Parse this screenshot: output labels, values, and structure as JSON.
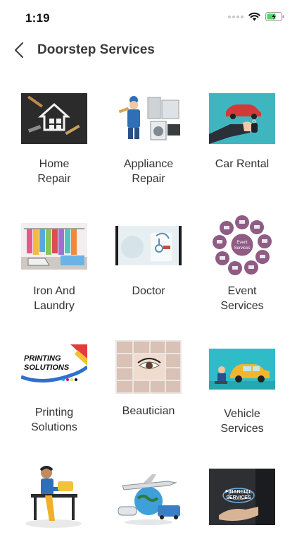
{
  "status": {
    "time": "1:19"
  },
  "nav": {
    "title": "Doorstep Services"
  },
  "services": [
    {
      "label": "Home\nRepair"
    },
    {
      "label": "Appliance\nRepair"
    },
    {
      "label": "Car Rental"
    },
    {
      "label": "Iron And\nLaundry"
    },
    {
      "label": "Doctor"
    },
    {
      "label": "Event\nServices"
    },
    {
      "label": "Printing\nSolutions"
    },
    {
      "label": "Beautician"
    },
    {
      "label": "Vehicle\nServices"
    },
    {
      "label": ""
    },
    {
      "label": ""
    },
    {
      "label": ""
    }
  ],
  "thumb_text": {
    "event_center": "Event\nServices",
    "printing_logo": "PRINTING\nSOLUTIONS",
    "finance": "FINANCIAL\nSERVICES"
  },
  "colors": {
    "accent": "#3fb6bf",
    "title": "#3a3a3a",
    "battery": "#4cd964"
  }
}
